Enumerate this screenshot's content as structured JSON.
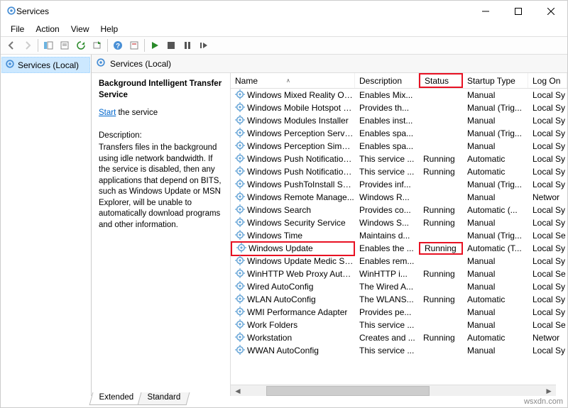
{
  "window": {
    "title": "Services"
  },
  "menu": {
    "file": "File",
    "action": "Action",
    "view": "View",
    "help": "Help"
  },
  "tree": {
    "root": "Services (Local)"
  },
  "panel": {
    "title": "Services (Local)"
  },
  "detail": {
    "selected": "Background Intelligent Transfer Service",
    "start_link": "Start",
    "start_suffix": " the service",
    "desc_label": "Description:",
    "desc_text": "Transfers files in the background using idle network bandwidth. If the service is disabled, then any applications that depend on BITS, such as Windows Update or MSN Explorer, will be unable to automatically download programs and other information."
  },
  "columns": {
    "name": "Name",
    "description": "Description",
    "status": "Status",
    "startup": "Startup Type",
    "logon": "Log On"
  },
  "tabs": {
    "extended": "Extended",
    "standard": "Standard"
  },
  "watermark": "wsxdn.com",
  "services": [
    {
      "name": "Windows Mixed Reality Op...",
      "desc": "Enables Mix...",
      "status": "",
      "startup": "Manual",
      "logon": "Local Sy"
    },
    {
      "name": "Windows Mobile Hotspot S...",
      "desc": "Provides th...",
      "status": "",
      "startup": "Manual (Trig...",
      "logon": "Local Sy"
    },
    {
      "name": "Windows Modules Installer",
      "desc": "Enables inst...",
      "status": "",
      "startup": "Manual",
      "logon": "Local Sy"
    },
    {
      "name": "Windows Perception Service",
      "desc": "Enables spa...",
      "status": "",
      "startup": "Manual (Trig...",
      "logon": "Local Sy"
    },
    {
      "name": "Windows Perception Simul...",
      "desc": "Enables spa...",
      "status": "",
      "startup": "Manual",
      "logon": "Local Sy"
    },
    {
      "name": "Windows Push Notification...",
      "desc": "This service ...",
      "status": "Running",
      "startup": "Automatic",
      "logon": "Local Sy"
    },
    {
      "name": "Windows Push Notification...",
      "desc": "This service ...",
      "status": "Running",
      "startup": "Automatic",
      "logon": "Local Sy"
    },
    {
      "name": "Windows PushToInstall Serv...",
      "desc": "Provides inf...",
      "status": "",
      "startup": "Manual (Trig...",
      "logon": "Local Sy"
    },
    {
      "name": "Windows Remote Manage...",
      "desc": "Windows R...",
      "status": "",
      "startup": "Manual",
      "logon": "Networ"
    },
    {
      "name": "Windows Search",
      "desc": "Provides co...",
      "status": "Running",
      "startup": "Automatic (...",
      "logon": "Local Sy"
    },
    {
      "name": "Windows Security Service",
      "desc": "Windows S...",
      "status": "Running",
      "startup": "Manual",
      "logon": "Local Sy"
    },
    {
      "name": "Windows Time",
      "desc": "Maintains d...",
      "status": "",
      "startup": "Manual (Trig...",
      "logon": "Local Se"
    },
    {
      "name": "Windows Update",
      "desc": "Enables the ...",
      "status": "Running",
      "startup": "Automatic (T...",
      "logon": "Local Sy",
      "highlight": true
    },
    {
      "name": "Windows Update Medic Ser...",
      "desc": "Enables rem...",
      "status": "",
      "startup": "Manual",
      "logon": "Local Sy"
    },
    {
      "name": "WinHTTP Web Proxy Auto-...",
      "desc": "WinHTTP i...",
      "status": "Running",
      "startup": "Manual",
      "logon": "Local Se"
    },
    {
      "name": "Wired AutoConfig",
      "desc": "The Wired A...",
      "status": "",
      "startup": "Manual",
      "logon": "Local Sy"
    },
    {
      "name": "WLAN AutoConfig",
      "desc": "The WLANS...",
      "status": "Running",
      "startup": "Automatic",
      "logon": "Local Sy"
    },
    {
      "name": "WMI Performance Adapter",
      "desc": "Provides pe...",
      "status": "",
      "startup": "Manual",
      "logon": "Local Sy"
    },
    {
      "name": "Work Folders",
      "desc": "This service ...",
      "status": "",
      "startup": "Manual",
      "logon": "Local Se"
    },
    {
      "name": "Workstation",
      "desc": "Creates and ...",
      "status": "Running",
      "startup": "Automatic",
      "logon": "Networ"
    },
    {
      "name": "WWAN AutoConfig",
      "desc": "This service ...",
      "status": "",
      "startup": "Manual",
      "logon": "Local Sy"
    }
  ]
}
